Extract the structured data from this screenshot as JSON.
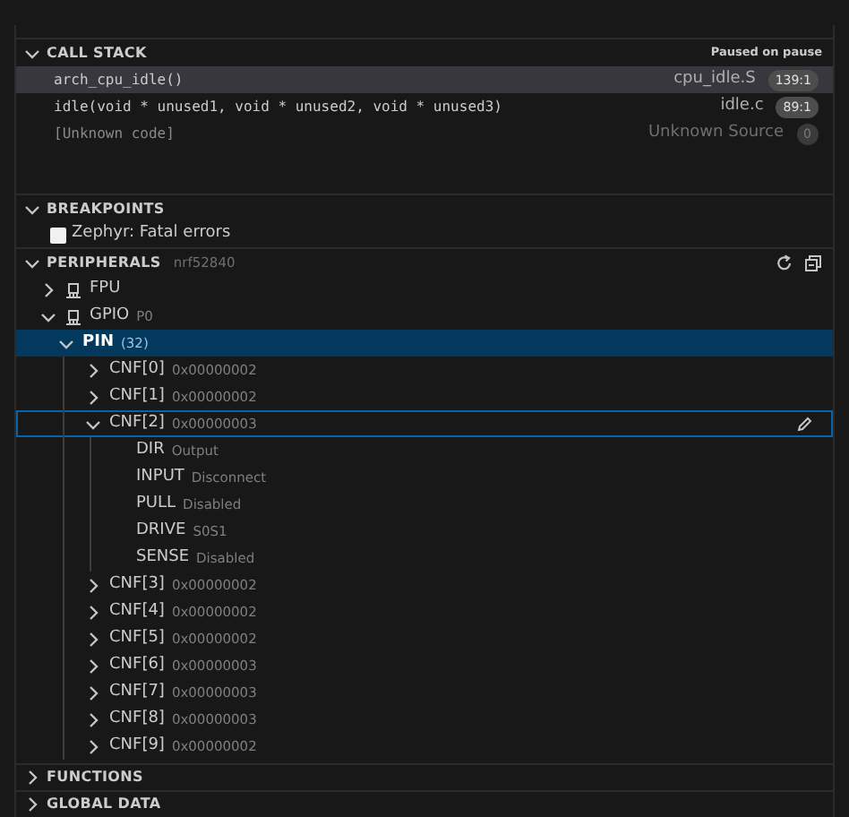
{
  "call_stack": {
    "title": "CALL STACK",
    "expanded": true,
    "status": "Paused on pause",
    "frames": [
      {
        "name": "arch_cpu_idle()",
        "file": "cpu_idle.S",
        "line": "139:1",
        "selected": true,
        "dimmed": false
      },
      {
        "name": "idle(void * unused1, void * unused2, void * unused3)",
        "file": "idle.c",
        "line": "89:1",
        "selected": false,
        "dimmed": false
      },
      {
        "name": "[Unknown code]",
        "file": "Unknown Source",
        "line": "0",
        "selected": false,
        "dimmed": true
      }
    ]
  },
  "breakpoints": {
    "title": "BREAKPOINTS",
    "expanded": true,
    "items": [
      {
        "label": "Zephyr: Fatal errors",
        "checked": false
      }
    ]
  },
  "peripherals": {
    "title": "PERIPHERALS",
    "subtitle": "nrf52840",
    "expanded": true,
    "items": [
      {
        "label": "FPU",
        "kind": "peripheral",
        "expanded": false,
        "selected": false,
        "focused": false
      },
      {
        "label": "GPIO",
        "value": "P0",
        "kind": "peripheral",
        "expanded": true,
        "selected": false,
        "focused": false,
        "children": [
          {
            "label": "PIN",
            "value": "(32)",
            "kind": "register",
            "expanded": true,
            "selected": true,
            "focused": false,
            "children": [
              {
                "label": "CNF[0]",
                "value": "0x00000002",
                "kind": "register",
                "expanded": false,
                "selected": false,
                "focused": false
              },
              {
                "label": "CNF[1]",
                "value": "0x00000002",
                "kind": "register",
                "expanded": false,
                "selected": false,
                "focused": false
              },
              {
                "label": "CNF[2]",
                "value": "0x00000003",
                "kind": "register",
                "expanded": true,
                "selected": false,
                "focused": true,
                "children": [
                  {
                    "label": "DIR",
                    "value": "Output",
                    "kind": "field"
                  },
                  {
                    "label": "INPUT",
                    "value": "Disconnect",
                    "kind": "field"
                  },
                  {
                    "label": "PULL",
                    "value": "Disabled",
                    "kind": "field"
                  },
                  {
                    "label": "DRIVE",
                    "value": "S0S1",
                    "kind": "field"
                  },
                  {
                    "label": "SENSE",
                    "value": "Disabled",
                    "kind": "field"
                  }
                ]
              },
              {
                "label": "CNF[3]",
                "value": "0x00000002",
                "kind": "register",
                "expanded": false,
                "selected": false,
                "focused": false
              },
              {
                "label": "CNF[4]",
                "value": "0x00000002",
                "kind": "register",
                "expanded": false,
                "selected": false,
                "focused": false
              },
              {
                "label": "CNF[5]",
                "value": "0x00000002",
                "kind": "register",
                "expanded": false,
                "selected": false,
                "focused": false
              },
              {
                "label": "CNF[6]",
                "value": "0x00000003",
                "kind": "register",
                "expanded": false,
                "selected": false,
                "focused": false
              },
              {
                "label": "CNF[7]",
                "value": "0x00000003",
                "kind": "register",
                "expanded": false,
                "selected": false,
                "focused": false
              },
              {
                "label": "CNF[8]",
                "value": "0x00000003",
                "kind": "register",
                "expanded": false,
                "selected": false,
                "focused": false
              },
              {
                "label": "CNF[9]",
                "value": "0x00000002",
                "kind": "register",
                "expanded": false,
                "selected": false,
                "focused": false
              }
            ]
          }
        ]
      }
    ]
  },
  "collapsed_sections": [
    {
      "title": "FUNCTIONS",
      "expanded": false
    },
    {
      "title": "GLOBAL DATA",
      "expanded": false
    }
  ]
}
